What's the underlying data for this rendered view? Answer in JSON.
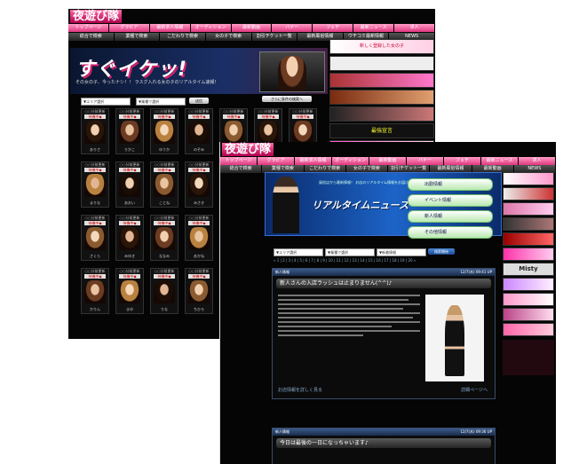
{
  "screenshot1": {
    "site_logo": "夜遊び隊",
    "nav_primary": [
      "トップページ",
      "グラビア",
      "最新求人情報",
      "オーディション",
      "最新動画",
      "バナー",
      "フェチ",
      "最新ニュース",
      "求人"
    ],
    "nav_secondary": [
      "総合で検索",
      "業種で検索",
      "こだわりで検索",
      "女の子で検索",
      "割引チケット一覧",
      "最新風俗情報",
      "ウチコミ最新情報",
      "NEWS"
    ],
    "banner_title": "すぐイケッ!",
    "banner_star": "★",
    "banner_caption": "その女の子、今ったナシ！！ ラスグ入れる女の子のリアルタイム速報！",
    "filter_area": "▼エリア選択",
    "filter_type": "▼業種で選択",
    "filter_submit": "送信",
    "search_box_label": "さらに条件の検索へ",
    "card_header": "○○分前更新",
    "card_badge": "待機中◆",
    "card_names": [
      "ありさ",
      "りかこ",
      "ゆうか",
      "のぞみ",
      "さやか",
      "あいり",
      "れいな",
      "まりな",
      "あおい",
      "ことね",
      "みさき",
      "えみり",
      "かなえ",
      "ひかり",
      "さくら",
      "みゆき",
      "ななみ",
      "あかね",
      "ゆりあ",
      "めぐみ",
      "しずか",
      "かりん",
      "まゆ",
      "りな",
      "ちひろ",
      "すず",
      "あやか",
      "みなみ"
    ],
    "sidebar_ad_top": "新しく登録した女の子",
    "sidebar_ad_mid": "最強宣言"
  },
  "screenshot2": {
    "site_logo": "夜遊び隊",
    "nav_primary": [
      "トップページ",
      "グラビア",
      "最新求人情報",
      "オーディション",
      "最新動画",
      "バナー",
      "フェチ",
      "最新ニュース",
      "求人"
    ],
    "nav_secondary": [
      "総合で検索",
      "業種で検索",
      "こだわりで検索",
      "女の子で検索",
      "割引チケット一覧",
      "最新風俗情報",
      "最新動画",
      "NEWS"
    ],
    "banner_title": "リアルタイムニュース",
    "banner_subtitle": "風俗店から最新情報！ お店のリアルタイム情報をお届けします",
    "banner_menu": [
      "出勤情報",
      "イベント情報",
      "新人情報",
      "その他情報"
    ],
    "filter_area": "▼エリア選択",
    "filter_type": "▼業種で選択",
    "filter_category": "▼新着情報",
    "filter_submit": "検索開始",
    "paging": "« 1 | 2 | 3 | 4 | 5 | 6 | 7 | 8 | 9 | 10 | 11 | 12 | 13 | 14 | 15 | 16 | 17 | 18 | 19 | 20 »",
    "articles": [
      {
        "category": "新人情報",
        "date": "12/7(木) 09:41 UP",
        "title": "新人さんの入店ラッシュは止まりません(^^)♪",
        "footer_left": "お店情報を詳しく見る",
        "footer_right": "詳細ページへ"
      },
      {
        "category": "新人情報",
        "date": "12/7(木) 09:36 UP",
        "title": "今日は最後の一日になっちゃいます♪"
      }
    ],
    "side_ad_label": "Misty"
  }
}
